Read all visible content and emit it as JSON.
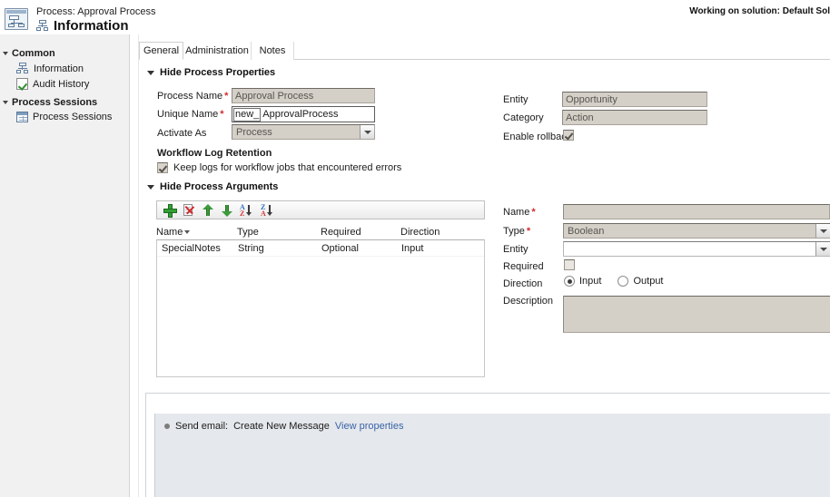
{
  "header": {
    "process_label": "Process: Approval Process",
    "title": "Information",
    "solution_text": "Working on solution: Default Sol",
    "icon": "process-icon",
    "title_icon": "process-small-icon"
  },
  "sidebar": {
    "groups": [
      {
        "label": "Common",
        "items": [
          {
            "label": "Information",
            "icon": "process-small-icon"
          },
          {
            "label": "Audit History",
            "icon": "audit-history-icon"
          }
        ]
      },
      {
        "label": "Process Sessions",
        "items": [
          {
            "label": "Process Sessions",
            "icon": "grid-icon"
          }
        ]
      }
    ]
  },
  "tabs": [
    {
      "label": "General",
      "active": true
    },
    {
      "label": "Administration",
      "active": false
    },
    {
      "label": "Notes",
      "active": false
    }
  ],
  "process_properties": {
    "section_label": "Hide Process Properties",
    "left": {
      "process_name_label": "Process Name",
      "process_name_value": "Approval Process",
      "unique_name_label": "Unique Name",
      "unique_name_prefix": "new_",
      "unique_name_value": "ApprovalProcess",
      "activate_as_label": "Activate As",
      "activate_as_value": "Process"
    },
    "right": {
      "entity_label": "Entity",
      "entity_value": "Opportunity",
      "category_label": "Category",
      "category_value": "Action",
      "enable_rollback_label": "Enable rollback",
      "enable_rollback_checked": true
    },
    "log_retention": {
      "heading": "Workflow Log Retention",
      "checkbox_label": "Keep logs for workflow jobs that encountered errors",
      "checked": true
    }
  },
  "process_arguments": {
    "section_label": "Hide Process Arguments",
    "toolbar": [
      {
        "name": "add-argument-button",
        "icon": "plus-icon"
      },
      {
        "name": "delete-argument-button",
        "icon": "delete-document-icon"
      },
      {
        "name": "move-up-button",
        "icon": "arrow-up-icon"
      },
      {
        "name": "move-down-button",
        "icon": "arrow-down-icon"
      },
      {
        "name": "sort-ascending-button",
        "icon": "sort-az-icon",
        "top": "A",
        "bottom": "Z"
      },
      {
        "name": "sort-descending-button",
        "icon": "sort-za-icon",
        "top": "Z",
        "bottom": "A"
      }
    ],
    "columns": [
      "Name",
      "Type",
      "Required",
      "Direction"
    ],
    "sorted_column": "Name",
    "rows": [
      {
        "name": "SpecialNotes",
        "type": "String",
        "required": "Optional",
        "direction": "Input"
      }
    ],
    "detail": {
      "name_label": "Name",
      "name_value": "",
      "type_label": "Type",
      "type_value": "Boolean",
      "entity_label": "Entity",
      "entity_value": "",
      "required_label": "Required",
      "required_checked": false,
      "direction_label": "Direction",
      "direction_input_label": "Input",
      "direction_output_label": "Output",
      "direction_selected": "Input",
      "description_label": "Description",
      "description_value": ""
    }
  },
  "steps": {
    "rows": [
      {
        "prefix": "Send email:",
        "text": "Create New Message",
        "link": "View properties"
      }
    ]
  },
  "colors": {
    "accent_link": "#3a63a8",
    "required_asterisk": "#d12d2d",
    "disabled_field_bg": "#d4d0c8",
    "sidebar_bg": "#f1f1f1",
    "steps_bg": "#e5e8ec",
    "add_icon_green": "#35a035",
    "delete_icon_red": "#cf2a2a"
  }
}
